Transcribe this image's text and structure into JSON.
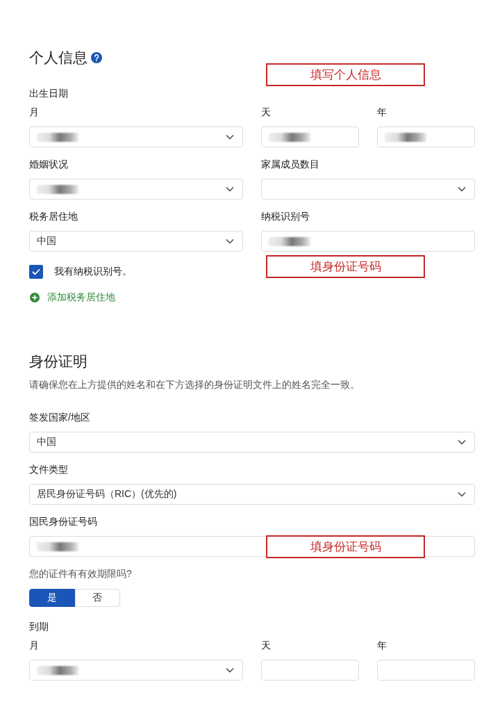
{
  "blocks": [
    {
      "kind": "heading",
      "text": "个人信息",
      "help": true,
      "annotation": "填写个人信息"
    },
    {
      "kind": "caption",
      "text": "出生日期"
    },
    {
      "kind": "fields",
      "items": [
        {
          "label": "月",
          "kind": "select",
          "redacted": true
        },
        {
          "label": "天",
          "kind": "text",
          "redacted": true
        },
        {
          "label": "年",
          "kind": "text",
          "redacted": true
        }
      ]
    },
    {
      "kind": "fields",
      "items": [
        {
          "label": "婚姻状况",
          "kind": "select",
          "redacted": true
        },
        {
          "label": "家属成员数目",
          "kind": "select",
          "redacted": false
        }
      ]
    },
    {
      "kind": "fields",
      "items": [
        {
          "label": "税务居住地",
          "kind": "select",
          "value": "中国",
          "redacted": false
        },
        {
          "label": "纳税识别号",
          "kind": "text",
          "redacted": true
        }
      ]
    },
    {
      "kind": "checkbox",
      "text": "我有纳税识别号。",
      "checked": true,
      "annotation": "填身份证号码"
    },
    {
      "kind": "link",
      "text": "添加税务居住地"
    },
    {
      "kind": "heading",
      "text": "身份证明",
      "help": false
    },
    {
      "kind": "description",
      "text": "请确保您在上方提供的姓名和在下方选择的身份证明文件上的姓名完全一致。"
    },
    {
      "kind": "fields",
      "items": [
        {
          "label": "签发国家/地区",
          "kind": "select",
          "value": "中国",
          "redacted": false
        }
      ]
    },
    {
      "kind": "fields",
      "items": [
        {
          "label": "文件类型",
          "kind": "select",
          "value": "居民身份证号码（RIC）(优先的)",
          "redacted": false
        }
      ]
    },
    {
      "kind": "fields",
      "annotation": "填身份证号码",
      "items": [
        {
          "label": "国民身份证号码",
          "kind": "text",
          "redacted": true
        }
      ]
    },
    {
      "kind": "question",
      "text": "您的证件有有效期限吗?"
    },
    {
      "kind": "toggle",
      "options": [
        {
          "label": "是",
          "selected": true
        },
        {
          "label": "否",
          "selected": false
        }
      ]
    },
    {
      "kind": "caption",
      "text": "到期"
    },
    {
      "kind": "fields",
      "items": [
        {
          "label": "月",
          "kind": "select",
          "redacted": true
        },
        {
          "label": "天",
          "kind": "text",
          "redacted": false
        },
        {
          "label": "年",
          "kind": "text",
          "redacted": false
        }
      ]
    }
  ]
}
